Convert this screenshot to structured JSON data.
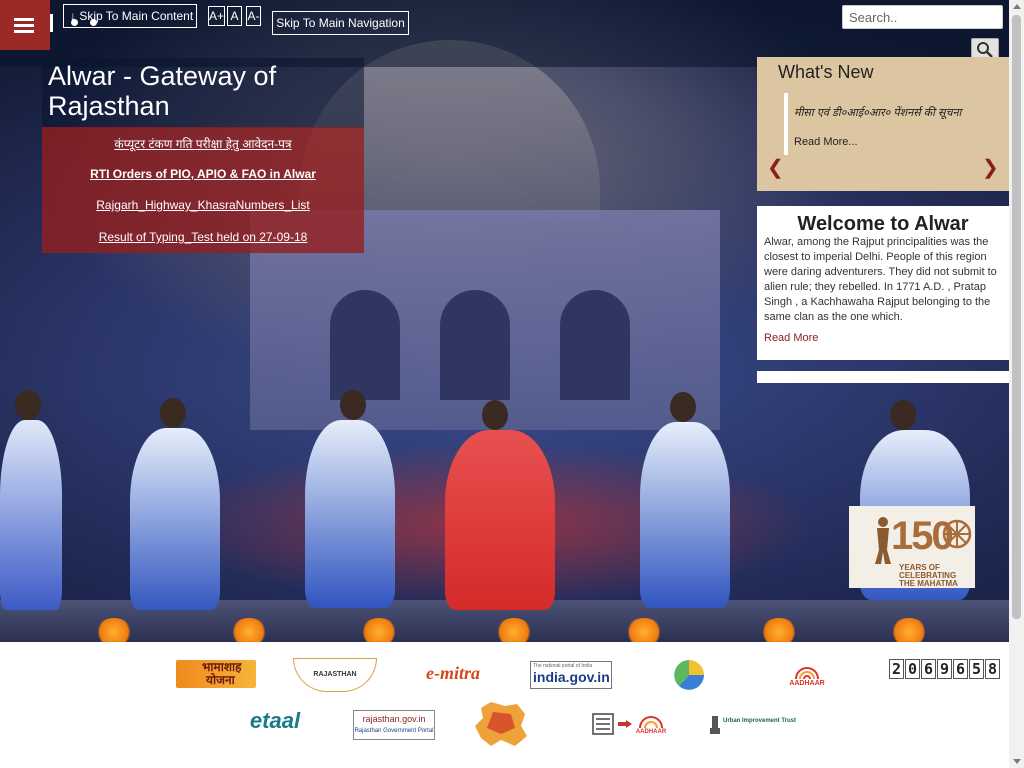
{
  "header": {
    "skip_main_content": "↓ Skip To Main Content",
    "font_increase": "A+",
    "font_normal": "A",
    "font_decrease": "A-",
    "skip_main_navigation": "Skip To Main Navigation",
    "search_placeholder": "Search.."
  },
  "hero": {
    "title": "Alwar - Gateway of Rajasthan",
    "news_links": [
      "कंप्यूटर टंकण गति परीक्षा हेतु आवेदन-पत्र",
      "RTI Orders of PIO, APIO & FAO in Alwar",
      "Rajgarh_Highway_KhasraNumbers_List",
      "Result of Typing_Test held on 27-09-18"
    ]
  },
  "whats_new": {
    "title": "What's New",
    "item": "मीसा एवं डी०आई०आर० पेंशनर्स की सूचना",
    "read_more": "Read More...",
    "prev": "❮",
    "next": "❯"
  },
  "welcome": {
    "title": "Welcome to Alwar",
    "text": "Alwar, among the Rajput principalities was the closest to imperial Delhi. People of this region were daring adventurers. They did not submit to alien rule; they rebelled. In 1771 A.D. , Pratap Singh , a Kachhawaha Rajput belonging to the same clan as the one which.",
    "read_more": "Read More"
  },
  "gandhi_banner": {
    "number": "150",
    "caption_line1": "YEARS OF",
    "caption_line2": "CELEBRATING",
    "caption_line3": "THE MAHATMA"
  },
  "footer_logos": {
    "bhamashah_line1": "भामाशाह",
    "bhamashah_line2": "योजना",
    "rajasthan": "RAJASTHAN",
    "emitra": "e-mitra",
    "indiagov": "india.gov.in",
    "indiagov_tag": "The national portal of India",
    "aadhaar": "AADHAAR",
    "etaal": "etaal",
    "rajasthan_gov": "rajasthan.gov.in",
    "rajasthan_gov_sub": "Rajasthan Government Portal",
    "aadhaar_link": "AADHAAR",
    "urban": "Urban Improvement Trust",
    "visitor_counter": [
      "2",
      "0",
      "6",
      "9",
      "6",
      "5",
      "8"
    ]
  }
}
